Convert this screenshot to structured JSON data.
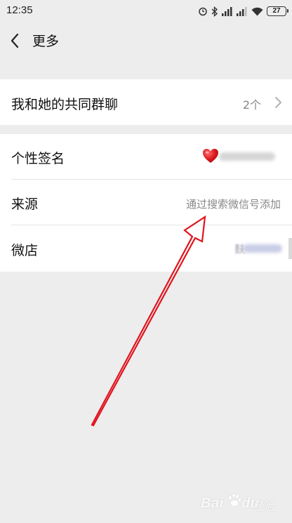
{
  "status_bar": {
    "time": "12:35",
    "battery": "27",
    "icons": [
      "alarm-icon",
      "bluetooth-icon",
      "signal-icon",
      "signal-icon",
      "wifi-icon",
      "battery-icon"
    ]
  },
  "header": {
    "title": "更多",
    "back_icon": "chevron-left-icon"
  },
  "cells": {
    "group_chats": {
      "label": "我和她的共同群聊",
      "value": "2个"
    },
    "signature": {
      "label": "个性签名",
      "emoji": "❤️"
    },
    "source": {
      "label": "来源",
      "value": "通过搜索微信号添加"
    },
    "shop": {
      "label": "微店",
      "value_lead": "麸"
    }
  },
  "watermark": {
    "brand": "Bai",
    "brand_tail": "du",
    "sub": "经验"
  },
  "colors": {
    "background": "#ededed",
    "cell": "#ffffff",
    "secondary_text": "#888888",
    "annotation_arrow": "#e0141e"
  }
}
